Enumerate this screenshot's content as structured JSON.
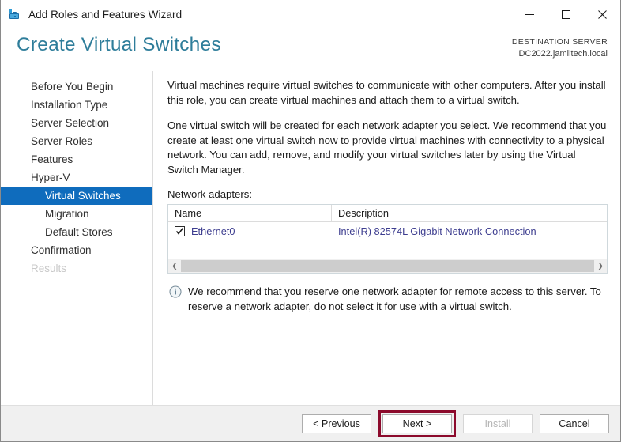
{
  "window": {
    "title": "Add Roles and Features Wizard",
    "icon": "wizard-server-icon",
    "controls": {
      "minimize": "minimize-icon",
      "maximize": "maximize-icon",
      "close": "close-icon"
    }
  },
  "header": {
    "page_title": "Create Virtual Switches",
    "destination_label": "DESTINATION SERVER",
    "destination_server": "DC2022.jamiltech.local",
    "title_color": "#2e7d9a"
  },
  "sidebar": {
    "items": [
      {
        "label": "Before You Begin",
        "level": 0,
        "state": "normal"
      },
      {
        "label": "Installation Type",
        "level": 0,
        "state": "normal"
      },
      {
        "label": "Server Selection",
        "level": 0,
        "state": "normal"
      },
      {
        "label": "Server Roles",
        "level": 0,
        "state": "normal"
      },
      {
        "label": "Features",
        "level": 0,
        "state": "normal"
      },
      {
        "label": "Hyper-V",
        "level": 0,
        "state": "normal"
      },
      {
        "label": "Virtual Switches",
        "level": 1,
        "state": "selected"
      },
      {
        "label": "Migration",
        "level": 1,
        "state": "normal"
      },
      {
        "label": "Default Stores",
        "level": 1,
        "state": "normal"
      },
      {
        "label": "Confirmation",
        "level": 0,
        "state": "normal"
      },
      {
        "label": "Results",
        "level": 0,
        "state": "disabled"
      }
    ],
    "selected_color": "#0f6cbd"
  },
  "main": {
    "paragraph1": "Virtual machines require virtual switches to communicate with other computers. After you install this role, you can create virtual machines and attach them to a virtual switch.",
    "paragraph2": "One virtual switch will be created for each network adapter you select. We recommend that you create at least one virtual switch now to provide virtual machines with connectivity to a physical network. You can add, remove, and modify your virtual switches later by using the Virtual Switch Manager.",
    "adapters_label": "Network adapters:",
    "table": {
      "columns": [
        "Name",
        "Description"
      ],
      "rows": [
        {
          "checked": true,
          "name": "Ethernet0",
          "description": "Intel(R) 82574L Gigabit Network Connection"
        }
      ]
    },
    "scrollbar": {
      "left_arrow": "chevron-left-icon",
      "right_arrow": "chevron-right-icon"
    },
    "note": {
      "icon": "info-icon",
      "text": "We recommend that you reserve one network adapter for remote access to this server. To reserve a network adapter, do not select it for use with a virtual switch."
    }
  },
  "footer": {
    "previous_label": "< Previous",
    "next_label": "Next >",
    "install_label": "Install",
    "cancel_label": "Cancel",
    "install_disabled": true,
    "highlight_color": "#8c0a2c"
  }
}
